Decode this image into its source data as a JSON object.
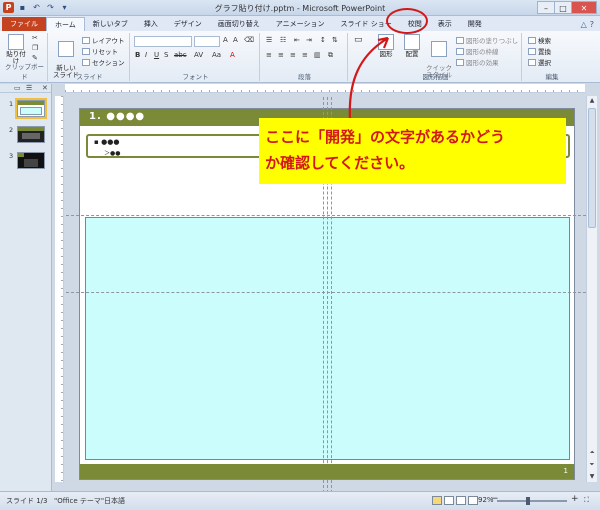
{
  "window": {
    "title": "グラフ貼り付け.pptm - Microsoft PowerPoint",
    "app_icon": "P"
  },
  "tabs": [
    {
      "label": "ファイル"
    },
    {
      "label": "ホーム"
    },
    {
      "label": "新しいタブ"
    },
    {
      "label": "挿入"
    },
    {
      "label": "デザイン"
    },
    {
      "label": "画面切り替え"
    },
    {
      "label": "アニメーション"
    },
    {
      "label": "スライド ショー"
    },
    {
      "label": "校閲"
    },
    {
      "label": "表示"
    },
    {
      "label": "開発"
    }
  ],
  "ribbon": {
    "clipboard": {
      "paste": "貼り付け",
      "label": "クリップボード"
    },
    "slides": {
      "new_slide": "新しい\nスライド",
      "layout": "レイアウト",
      "reset": "リセット",
      "section": "セクション",
      "label": "スライド"
    },
    "font": {
      "label": "フォント"
    },
    "paragraph": {
      "label": "段落"
    },
    "drawing": {
      "shapes": "図形",
      "arrange": "配置",
      "quick_styles": "クイック\nスタイル",
      "fill": "図形の塗りつぶし",
      "outline": "図形の枠線",
      "effects": "図形の効果",
      "label": "図形描画"
    },
    "editing": {
      "find": "検索",
      "replace": "置換",
      "select": "選択",
      "label": "編集"
    }
  },
  "slides_panel": {
    "thumbnails": [
      {
        "num": "1"
      },
      {
        "num": "2"
      },
      {
        "num": "3"
      }
    ]
  },
  "slide": {
    "title": "1. ●●●●",
    "bullet1": "▪ ●●●",
    "bullet2": "＞●●",
    "page_number": "1"
  },
  "annotation": {
    "line1": "ここに「開発」の文字があるかどう",
    "line2": "か確認してください。"
  },
  "status": {
    "slide": "スライド 1/3",
    "theme": "\"Office テーマ\"",
    "language": "日本語",
    "zoom": "92%"
  },
  "colors": {
    "accent_green": "#7a8a36",
    "annotation_red": "#d21818",
    "annotation_yellow": "#ffff00",
    "cyan_box": "#ccfdfd"
  }
}
